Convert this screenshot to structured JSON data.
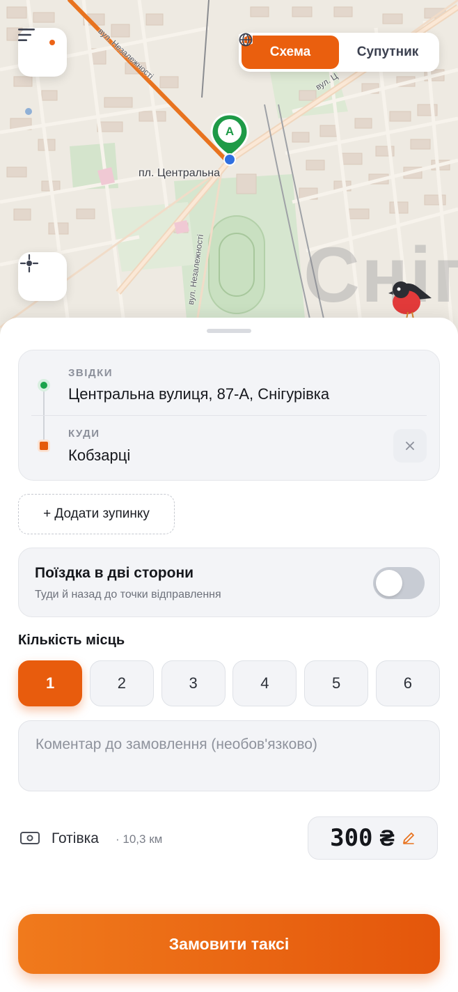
{
  "map": {
    "mode_options": [
      {
        "label": "Схема",
        "icon": "map-icon",
        "active": true
      },
      {
        "label": "Супутник",
        "icon": "globe-icon",
        "active": false
      }
    ],
    "marker_label": "A",
    "place_label": "пл. Центральна",
    "street_labels": {
      "nezalezhnosti": "вул. Незалежності",
      "central": "вул. Ц",
      "upper": "вул. Незалежності"
    },
    "city_watermark": "Снігу"
  },
  "route": {
    "from_label": "ЗВІДКИ",
    "from_value": "Центральна вулиця, 87-А, Снігурівка",
    "to_label": "КУДИ",
    "to_value": "Кобзарці"
  },
  "add_stop_label": "+ Додати зупинку",
  "round_trip": {
    "title": "Поїздка в дві сторони",
    "subtitle": "Туди й назад до точки відправлення",
    "enabled": false
  },
  "seats": {
    "title": "Кількість місць",
    "options": [
      "1",
      "2",
      "3",
      "4",
      "5",
      "6"
    ],
    "selected": "1"
  },
  "comment": {
    "placeholder": "Коментар до замовлення (необов'язково)",
    "value": ""
  },
  "payment": {
    "method": "Готівка",
    "distance": "· 10,3 км",
    "price": "300",
    "currency": "₴"
  },
  "order_button": "Замовити таксі",
  "colors": {
    "accent": "#E85C0D",
    "from_dot": "#1AA34A",
    "to_dot": "#E55A0B",
    "route_line": "#E8731F"
  }
}
